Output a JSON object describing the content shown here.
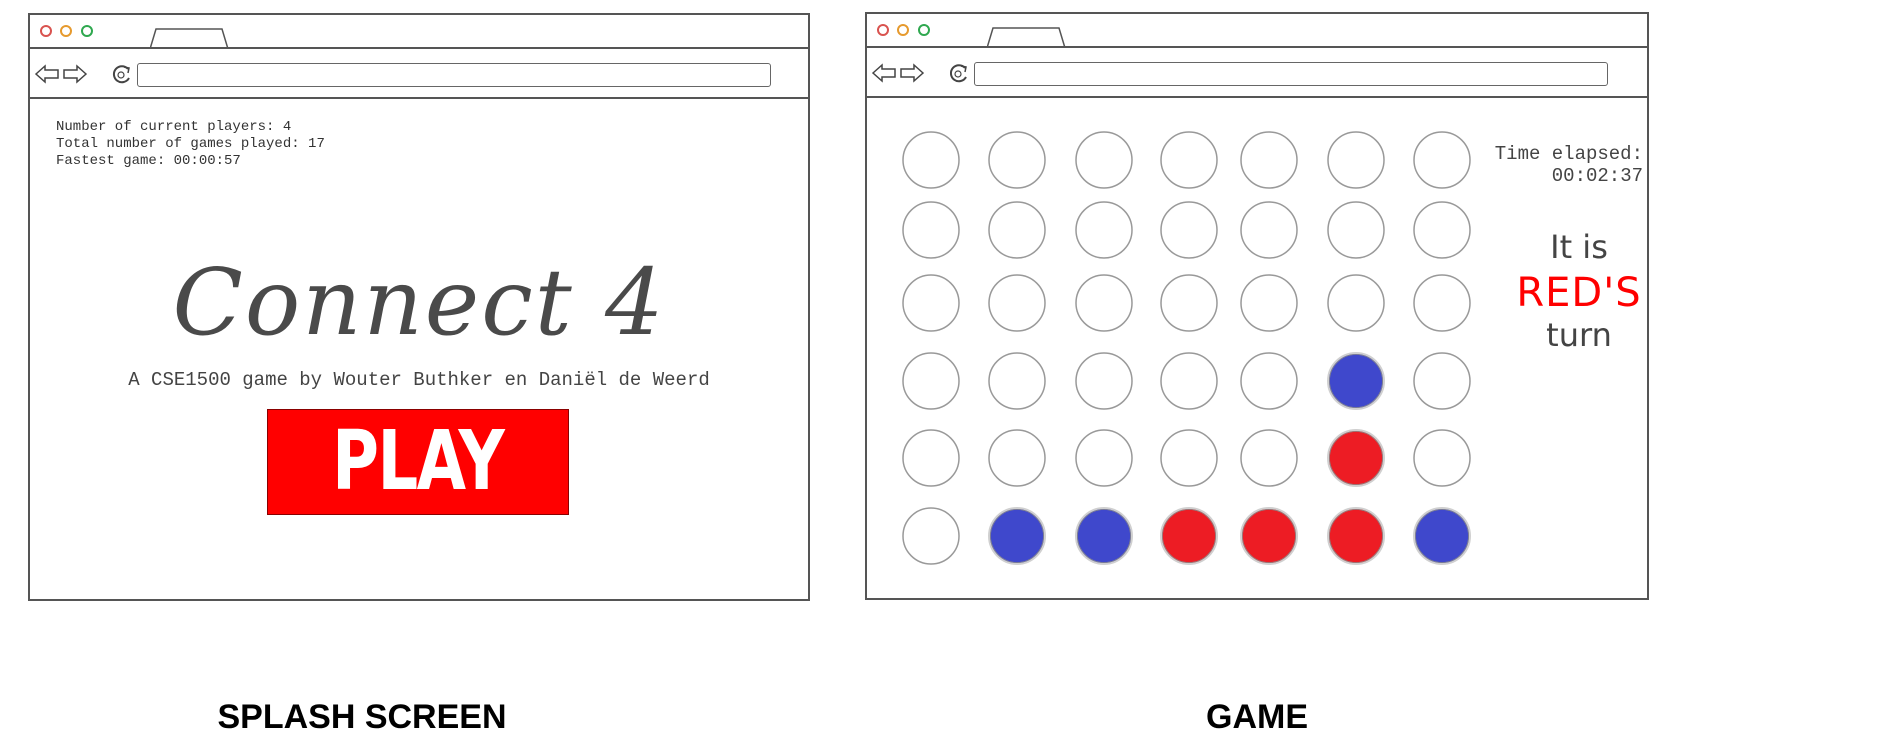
{
  "splash": {
    "caption": "SPLASH SCREEN",
    "stats": {
      "current_players": "Number of current players: 4",
      "games_played": "Total number of games played: 17",
      "fastest_game": "Fastest game: 00:00:57"
    },
    "title": "Connect 4",
    "subtitle": "A CSE1500 game by Wouter Buthker en Daniël de Weerd",
    "play_label": "PLAY"
  },
  "game": {
    "caption": "GAME",
    "timer_label": "Time elapsed:",
    "timer_value": "00:02:37",
    "turn_prefix": "It is",
    "turn_player": "RED'S",
    "turn_suffix": "turn",
    "board": [
      [
        "empty",
        "empty",
        "empty",
        "empty",
        "empty",
        "empty",
        "empty"
      ],
      [
        "empty",
        "empty",
        "empty",
        "empty",
        "empty",
        "empty",
        "empty"
      ],
      [
        "empty",
        "empty",
        "empty",
        "empty",
        "empty",
        "empty",
        "empty"
      ],
      [
        "empty",
        "empty",
        "empty",
        "empty",
        "empty",
        "blue",
        "empty"
      ],
      [
        "empty",
        "empty",
        "empty",
        "empty",
        "empty",
        "red",
        "empty"
      ],
      [
        "empty",
        "blue",
        "blue",
        "red",
        "red",
        "red",
        "blue"
      ]
    ]
  },
  "colors": {
    "red": "#ed1c24",
    "blue": "#3f48cc",
    "play_button": "#ff0000"
  },
  "icons": [
    "back-arrow-icon",
    "forward-arrow-icon",
    "refresh-icon"
  ]
}
